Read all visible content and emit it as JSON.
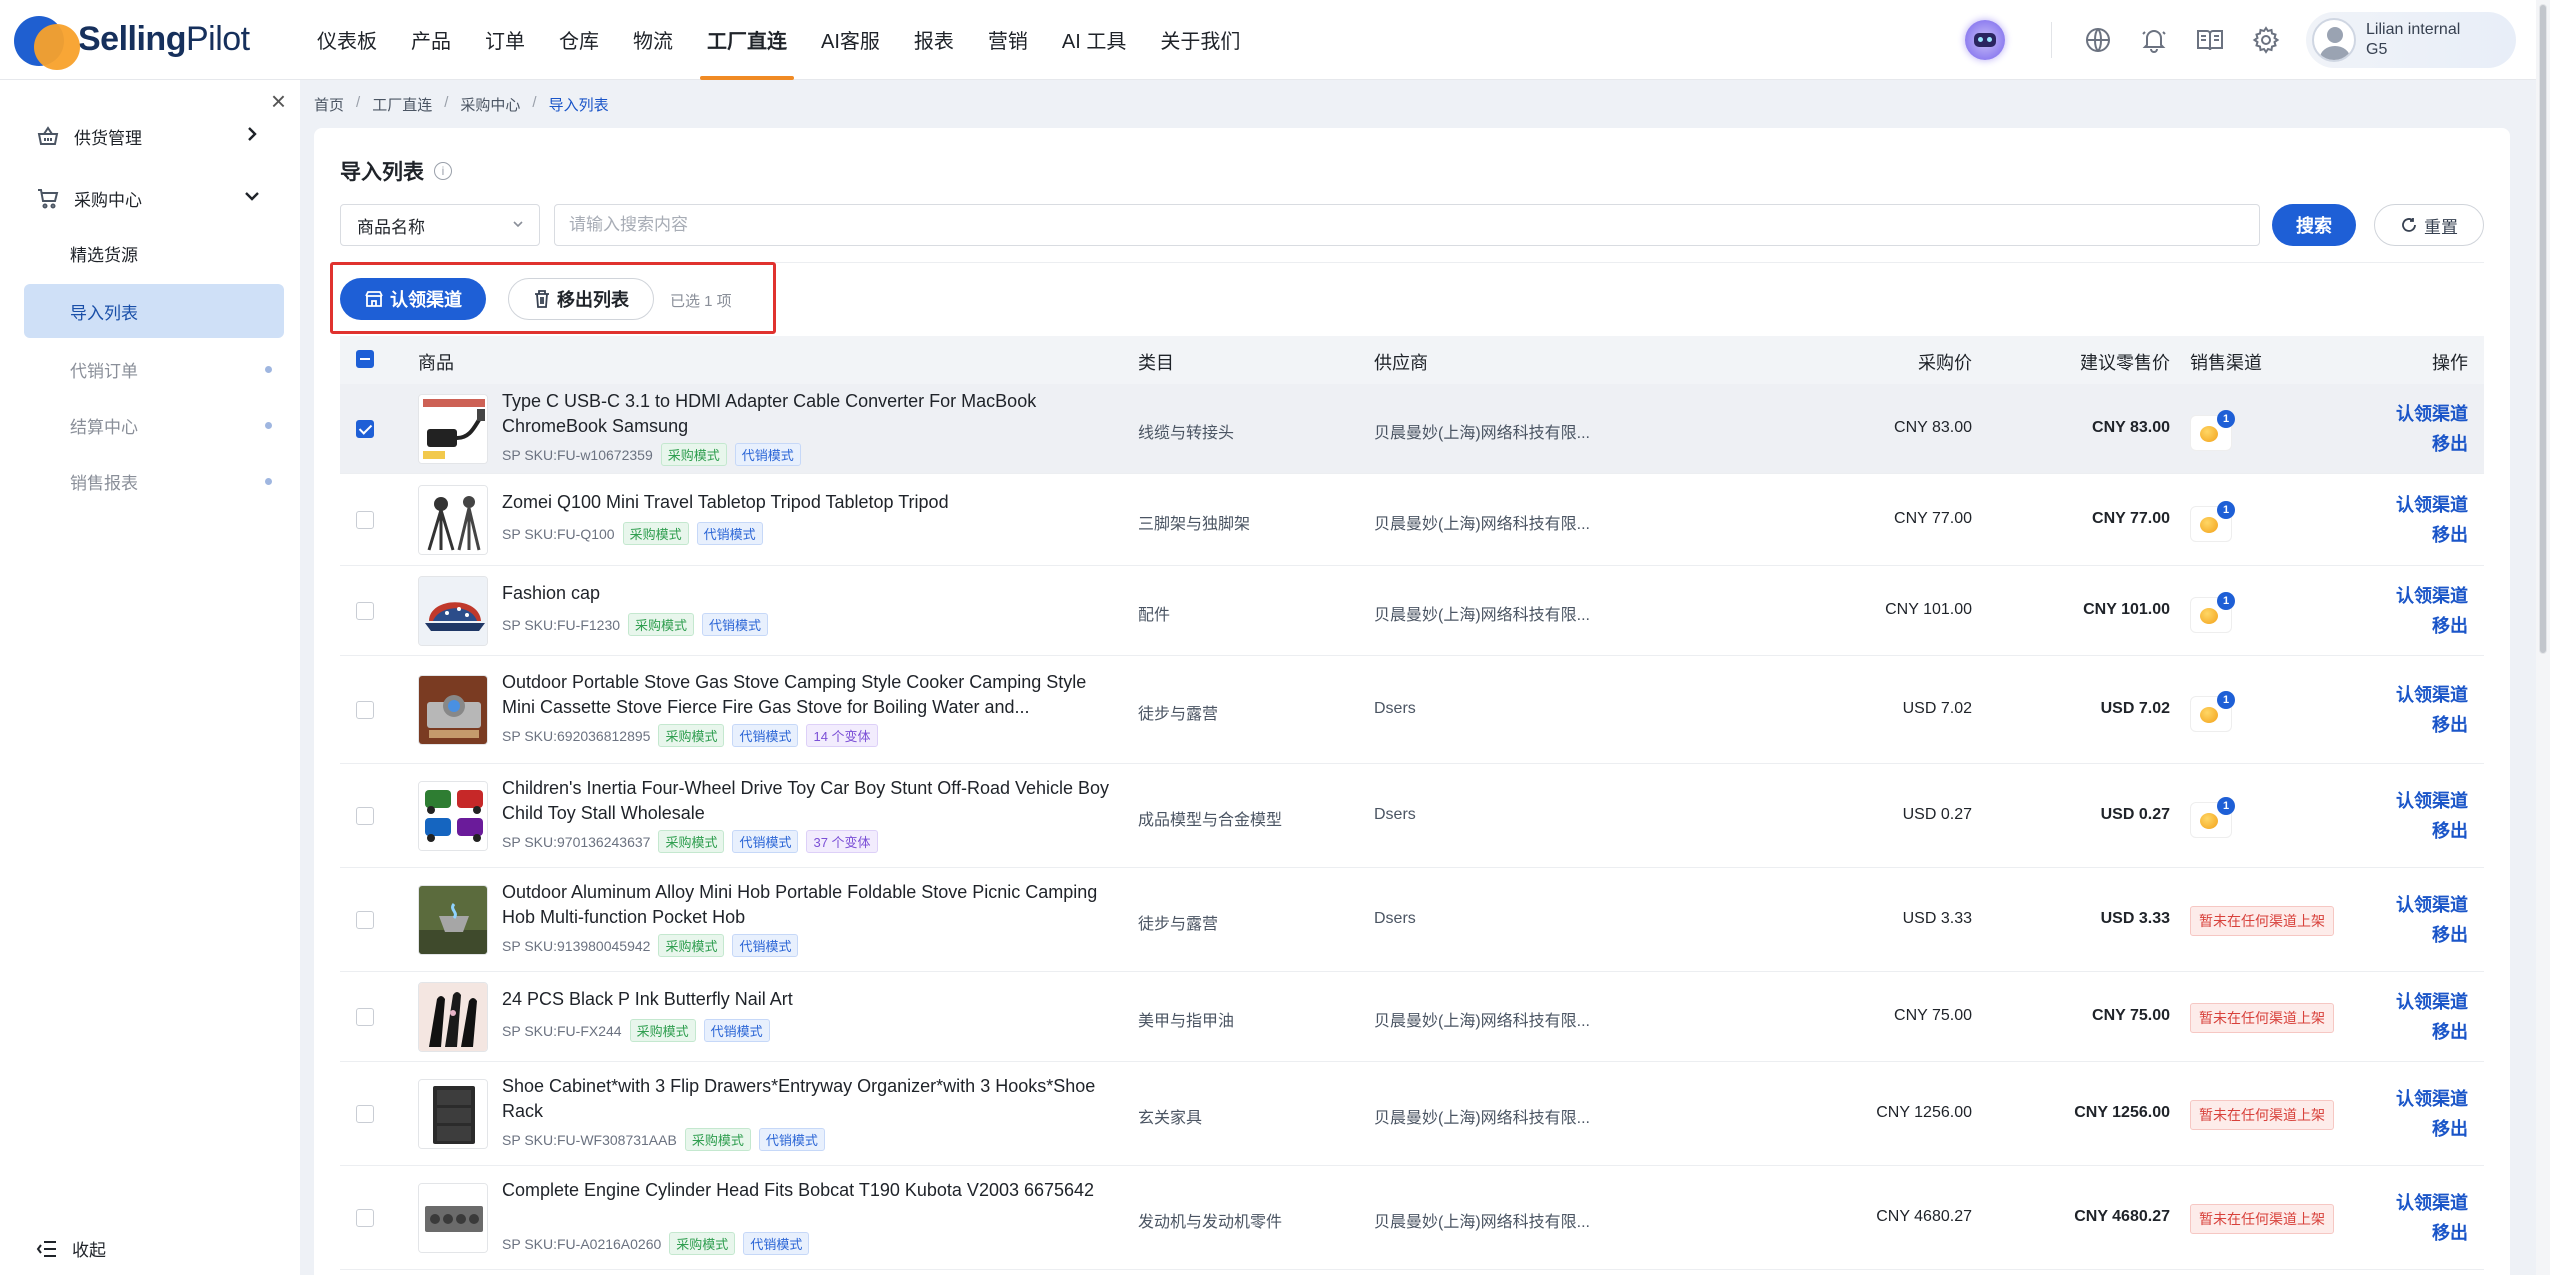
{
  "brand": {
    "name_bold": "Selling",
    "name_light": "Pilot",
    "accent": "#1e5fd6",
    "orange": "#f08a24"
  },
  "nav": [
    {
      "label": "仪表板",
      "active": false
    },
    {
      "label": "产品",
      "active": false
    },
    {
      "label": "订单",
      "active": false
    },
    {
      "label": "仓库",
      "active": false
    },
    {
      "label": "物流",
      "active": false
    },
    {
      "label": "工厂直连",
      "active": true
    },
    {
      "label": "AI客服",
      "active": false
    },
    {
      "label": "报表",
      "active": false
    },
    {
      "label": "营销",
      "active": false
    },
    {
      "label": "AI 工具",
      "active": false
    },
    {
      "label": "关于我们",
      "active": false
    }
  ],
  "user": {
    "name_line1": "Lilian internal",
    "name_line2": "G5"
  },
  "top_icons": [
    "robot-assistant-icon",
    "globe-icon",
    "bell-icon",
    "book-icon",
    "gear-icon"
  ],
  "sidebar": {
    "groups": [
      {
        "label": "供货管理",
        "icon": "basket-icon",
        "expanded": false
      },
      {
        "label": "采购中心",
        "icon": "cart-icon",
        "expanded": true
      }
    ],
    "items": [
      {
        "label": "精选货源",
        "active": false,
        "muted": false,
        "dot": false
      },
      {
        "label": "导入列表",
        "active": true,
        "muted": false,
        "dot": false
      },
      {
        "label": "代销订单",
        "active": false,
        "muted": true,
        "dot": true
      },
      {
        "label": "结算中心",
        "active": false,
        "muted": true,
        "dot": true
      },
      {
        "label": "销售报表",
        "active": false,
        "muted": true,
        "dot": true
      }
    ],
    "collapse_label": "收起"
  },
  "breadcrumb": [
    "首页",
    "工厂直连",
    "采购中心",
    "导入列表"
  ],
  "page": {
    "title": "导入列表",
    "filter_select": "商品名称",
    "search_placeholder": "请输入搜索内容",
    "search_label": "搜索",
    "reset_label": "重置",
    "claim_label": "认领渠道",
    "remove_label": "移出列表",
    "selected_text": "已选 1 项"
  },
  "table": {
    "headers": {
      "product": "商品",
      "category": "类目",
      "supplier": "供应商",
      "purchase_price": "采购价",
      "retail_price": "建议零售价",
      "channel": "销售渠道",
      "actions": "操作"
    },
    "op_claim": "认领渠道",
    "op_remove": "移出",
    "not_listed": "暂未在任何渠道上架",
    "sku_prefix": "SP SKU: ",
    "tag_purchase": "采购模式",
    "tag_consign": "代销模式",
    "rows": [
      {
        "name": "Type C USB-C 3.1 to HDMI Adapter Cable Converter For MacBook ChromeBook Samsung",
        "sku": "FU-w10672359",
        "variants": "",
        "category": "线缆与转接头",
        "supplier": "贝晨曼妙(上海)网络科技有限...",
        "price": "CNY 83.00",
        "retail": "CNY 83.00",
        "listed": true,
        "channels": "1",
        "selected": true,
        "thumb": "hdmi-adapter-thumb"
      },
      {
        "name": "Zomei Q100 Mini Travel Tabletop Tripod Tabletop Tripod",
        "sku": "FU-Q100",
        "variants": "",
        "category": "三脚架与独脚架",
        "supplier": "贝晨曼妙(上海)网络科技有限...",
        "price": "CNY 77.00",
        "retail": "CNY 77.00",
        "listed": true,
        "channels": "1",
        "selected": false,
        "thumb": "tripod-thumb"
      },
      {
        "name": "Fashion cap",
        "sku": "FU-F1230",
        "variants": "",
        "category": "配件",
        "supplier": "贝晨曼妙(上海)网络科技有限...",
        "price": "CNY 101.00",
        "retail": "CNY 101.00",
        "listed": true,
        "channels": "1",
        "selected": false,
        "thumb": "cap-thumb"
      },
      {
        "name": "Outdoor Portable Stove Gas Stove Camping Style Cooker Camping Style Mini Cassette Stove Fierce Fire Gas Stove for Boiling Water and...",
        "sku": "692036812895",
        "variants": "14 个变体",
        "category": "徒步与露营",
        "supplier": "Dsers",
        "price": "USD 7.02",
        "retail": "USD 7.02",
        "listed": true,
        "channels": "1",
        "selected": false,
        "thumb": "stove-thumb"
      },
      {
        "name": "Children's Inertia Four-Wheel Drive Toy Car Boy Stunt Off-Road Vehicle Boy Child Toy Stall Wholesale",
        "sku": "970136243637",
        "variants": "37 个变体",
        "category": "成品模型与合金模型",
        "supplier": "Dsers",
        "price": "USD 0.27",
        "retail": "USD 0.27",
        "listed": true,
        "channels": "1",
        "selected": false,
        "thumb": "toy-car-thumb"
      },
      {
        "name": "Outdoor Aluminum Alloy Mini Hob Portable Foldable Stove Picnic Camping Hob Multi-function Pocket Hob",
        "sku": "913980045942",
        "variants": "",
        "category": "徒步与露营",
        "supplier": "Dsers",
        "price": "USD 3.33",
        "retail": "USD 3.33",
        "listed": false,
        "channels": "",
        "selected": false,
        "thumb": "mini-hob-thumb"
      },
      {
        "name": "24 PCS Black P Ink Butterfly Nail Art",
        "sku": "FU-FX244",
        "variants": "",
        "category": "美甲与指甲油",
        "supplier": "贝晨曼妙(上海)网络科技有限...",
        "price": "CNY 75.00",
        "retail": "CNY 75.00",
        "listed": false,
        "channels": "",
        "selected": false,
        "thumb": "nail-art-thumb"
      },
      {
        "name": "Shoe Cabinet*with 3 Flip Drawers*Entryway Organizer*with 3 Hooks*Shoe Rack",
        "sku": "FU-WF308731AAB",
        "variants": "",
        "category": "玄关家具",
        "supplier": "贝晨曼妙(上海)网络科技有限...",
        "price": "CNY 1256.00",
        "retail": "CNY 1256.00",
        "listed": false,
        "channels": "",
        "selected": false,
        "thumb": "shoe-cabinet-thumb"
      },
      {
        "name": "Complete Engine Cylinder Head Fits Bobcat T190 Kubota V2003 6675642",
        "sku": "FU-A0216A0260",
        "variants": "",
        "category": "发动机与发动机零件",
        "supplier": "贝晨曼妙(上海)网络科技有限...",
        "price": "CNY 4680.27",
        "retail": "CNY 4680.27",
        "listed": false,
        "channels": "",
        "selected": false,
        "thumb": "cylinder-head-thumb"
      }
    ]
  }
}
